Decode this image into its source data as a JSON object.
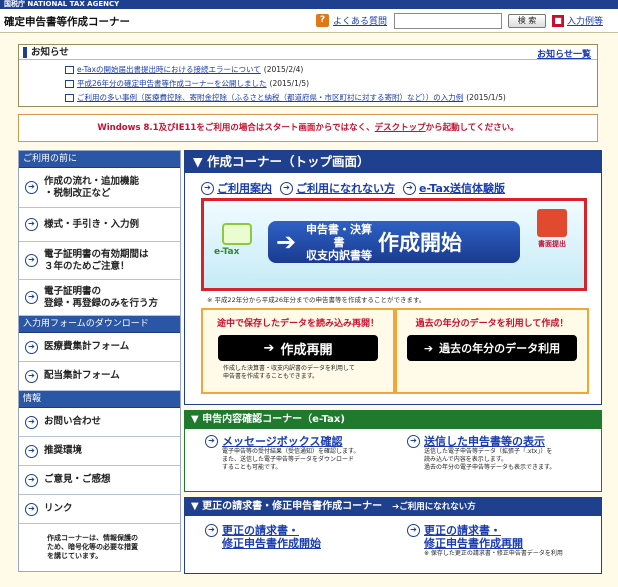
{
  "agency": "国税庁 NATIONAL TAX AGENCY",
  "site_title": "確定申告書等作成コーナー",
  "header": {
    "faq_label": "よくある質問",
    "search_placeholder": "",
    "search_button": "検 索",
    "example_label": "入力例等"
  },
  "notice": {
    "title": "お知らせ",
    "all_link": "お知らせ一覧",
    "items": [
      {
        "text": "e-Taxの開始届出書提出時における接続エラーについて",
        "date": "(2015/2/4)"
      },
      {
        "text": "平成26年分の確定申告書等作成コーナーを公開しました",
        "date": "(2015/1/5)"
      },
      {
        "text": "ご利用の多い事例（医療費控除、寄附金控除（ふるさと納税（都道府県・市区町村に対する寄附）など））の入力例",
        "date": "(2015/1/5)"
      }
    ]
  },
  "warning": {
    "pre": "Windows 8.1及びIE11をご利用の場合はスタート画面からではなく、",
    "link": "デスクトップ",
    "post": "から起動してください。"
  },
  "sidebar": {
    "sections": [
      {
        "title": "ご利用の前に",
        "items": [
          "作成の流れ・追加機能\n・税制改正など",
          "様式・手引き・入力例",
          "電子証明書の有効期間は\n３年のためご注意！",
          "電子証明書の\n登録・再登録のみを行う方"
        ]
      },
      {
        "title": "入力用フォームのダウンロード",
        "items": [
          "医療費集計フォーム",
          "配当集計フォーム"
        ]
      },
      {
        "title": "情報",
        "items": [
          "お問い合わせ",
          "推奨環境",
          "ご意見・ご感想",
          "リンク"
        ]
      }
    ],
    "footer": "作成コーナーは、情報保護の\nため、暗号化等の必要な措置\nを講じています。"
  },
  "main": {
    "title": "▼ 作成コーナー（トップ画面）",
    "links": [
      "ご利用案内",
      "ご利用になれない方",
      "e-Tax送信体験版"
    ],
    "banner": {
      "small1": "申告書・決算書",
      "small2": "収支内訳書等",
      "big": "作成開始",
      "etax": "e-Tax",
      "submit": "書面提出"
    },
    "banner_note": "※ 平成22年分から平成26年分までの申告書等を作成することができます。",
    "resume": {
      "heading": "途中で保存したデータを読み込み再開！",
      "button": "作成再開",
      "note": "作成した決算書・収支内訳書のデータを利用して\n申告書を作成することもできます。"
    },
    "past": {
      "heading": "過去の年分のデータを利用して作成！",
      "button": "過去の年分のデータ利用"
    }
  },
  "confirm": {
    "title": "▼ 申告内容確認コーナー（e-Tax)",
    "left_title": "メッセージボックス確認",
    "left_desc": "電子申告等の受付結果（受信通知）を確認します。\nまた、送信した電子申告等データをダウンロード\nすることも可能です。",
    "right_title": "送信した申告書等の表示",
    "right_desc": "送信した電子申告等データ（拡張子「.xtx」）を\n読み込んで内容を表示します。\n過去の年分の電子申告等データも表示できます。"
  },
  "correction": {
    "title": "▼ 更正の請求書・修正申告書作成コーナー",
    "unavailable": "ご利用になれない方",
    "left_title": "更正の請求書・\n修正申告書作成開始",
    "right_title": "更正の請求書・\n修正申告書作成再開",
    "right_desc": "※ 保存した更正の請求書・修正申告書データを利用"
  },
  "colors": {
    "navy": "#1f3f8f",
    "green": "#1f7a2e",
    "red": "#d7222a"
  }
}
